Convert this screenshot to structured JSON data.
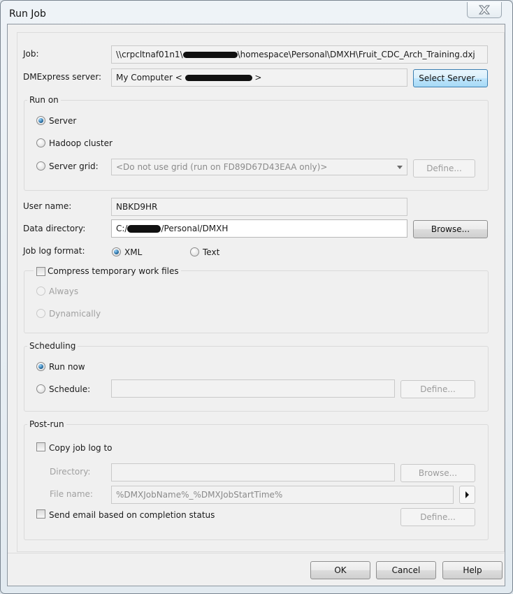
{
  "window": {
    "title": "Run Job",
    "close_icon": "close-x-icon"
  },
  "job": {
    "label": "Job:",
    "value_prefix": "\\\\crpcltnaf01n1\\",
    "value_suffix": "\\homespace\\Personal\\DMXH\\Fruit_CDC_Arch_Training.dxj"
  },
  "server": {
    "label": "DMExpress server:",
    "value_prefix": "My Computer < ",
    "value_suffix": " >",
    "select_button": "Select Server..."
  },
  "run_on": {
    "title": "Run on",
    "options": [
      {
        "label": "Server",
        "selected": true
      },
      {
        "label": "Hadoop cluster",
        "selected": false
      },
      {
        "label": "Server grid:",
        "selected": false
      }
    ],
    "grid_select_value": "<Do not use grid (run on FD89D67D43EAA only)>",
    "define_button": "Define..."
  },
  "user": {
    "label": "User name:",
    "value": "NBKD9HR"
  },
  "data_directory": {
    "label": "Data directory:",
    "value_prefix": "C:/",
    "value_suffix": "/Personal/DMXH",
    "browse_button": "Browse..."
  },
  "log_format": {
    "label": "Job log format:",
    "options": [
      {
        "label": "XML",
        "selected": true
      },
      {
        "label": "Text",
        "selected": false
      }
    ]
  },
  "compress": {
    "title": "Compress temporary work files",
    "checked": false,
    "options": [
      {
        "label": "Always"
      },
      {
        "label": "Dynamically"
      }
    ]
  },
  "scheduling": {
    "title": "Scheduling",
    "options": [
      {
        "label": "Run now",
        "selected": true
      },
      {
        "label": "Schedule:",
        "selected": false
      }
    ],
    "schedule_value": "",
    "define_button": "Define..."
  },
  "post_run": {
    "title": "Post-run",
    "copy_log": {
      "label": "Copy job log to",
      "checked": false
    },
    "directory": {
      "label": "Directory:",
      "value": "",
      "browse_button": "Browse..."
    },
    "file_name": {
      "label": "File name:",
      "value": "%DMXJobName%_%DMXJobStartTime%"
    },
    "send_email": {
      "label": "Send email based on completion status",
      "checked": false,
      "define_button": "Define..."
    }
  },
  "footer": {
    "ok": "OK",
    "cancel": "Cancel",
    "help": "Help"
  }
}
